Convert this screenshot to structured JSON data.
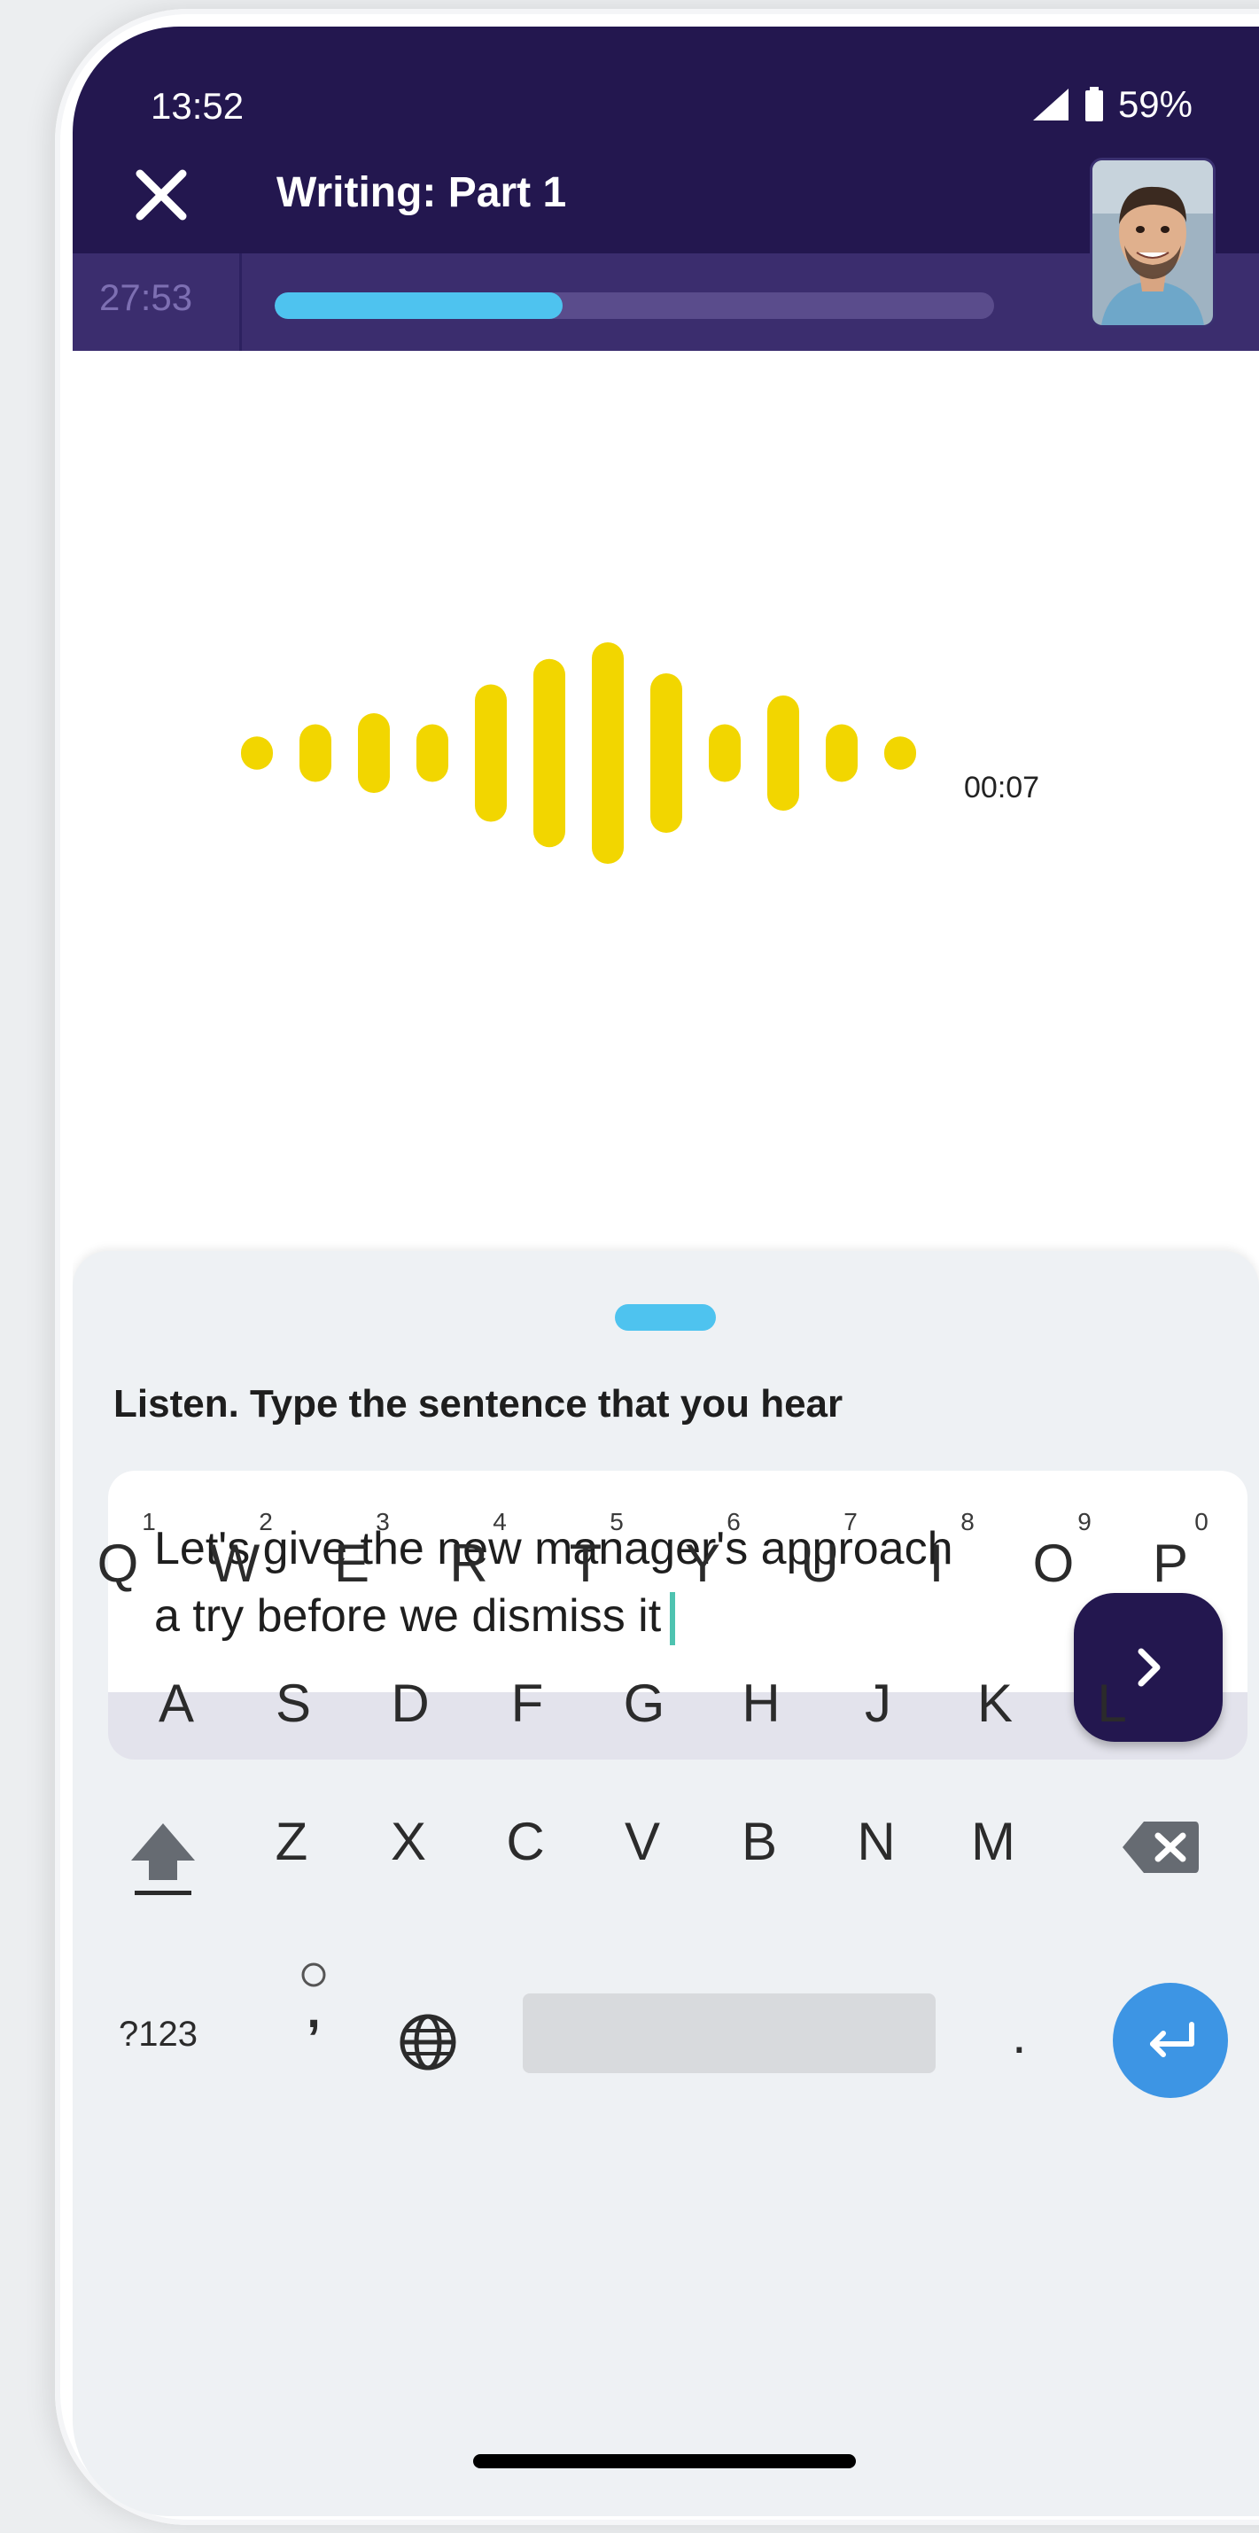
{
  "status_bar": {
    "time": "13:52",
    "battery": "59%"
  },
  "header": {
    "title": "Writing: Part 1",
    "close_icon": "close-icon",
    "avatar": "tutor-avatar"
  },
  "timer": {
    "remaining": "27:53",
    "progress_fraction": 0.4
  },
  "audio": {
    "elapsed": "00:07",
    "bar_heights": [
      0.15,
      0.26,
      0.36,
      0.26,
      0.62,
      0.85,
      1.0,
      0.72,
      0.26,
      0.52,
      0.26,
      0.15
    ]
  },
  "exercise": {
    "instruction": "Listen. Type the sentence that you hear",
    "answer_line1": "Let's give the new manager's approach",
    "answer_line2": "a try before we dismiss it"
  },
  "keyboard": {
    "row1": [
      {
        "key": "Q",
        "hint": "1"
      },
      {
        "key": "W",
        "hint": "2"
      },
      {
        "key": "E",
        "hint": "3"
      },
      {
        "key": "R",
        "hint": "4"
      },
      {
        "key": "T",
        "hint": "5"
      },
      {
        "key": "Y",
        "hint": "6"
      },
      {
        "key": "U",
        "hint": "7"
      },
      {
        "key": "I",
        "hint": "8"
      },
      {
        "key": "O",
        "hint": "9"
      },
      {
        "key": "P",
        "hint": "0"
      }
    ],
    "row2": [
      "A",
      "S",
      "D",
      "F",
      "G",
      "H",
      "J",
      "K",
      "L"
    ],
    "row3": [
      "Z",
      "X",
      "C",
      "V",
      "B",
      "N",
      "M"
    ],
    "numbers_key": "?123",
    "comma_key": ",",
    "period_key": ".",
    "icons": [
      "shift-icon",
      "backspace-icon",
      "globe-icon",
      "enter-icon"
    ]
  },
  "colors": {
    "header": "#23174f",
    "timer_bar": "#3b2d6e",
    "accent_blue": "#4ec3ef",
    "waveform": "#f2d600",
    "caret": "#4ec3b0",
    "enter_key": "#3d95e4"
  }
}
